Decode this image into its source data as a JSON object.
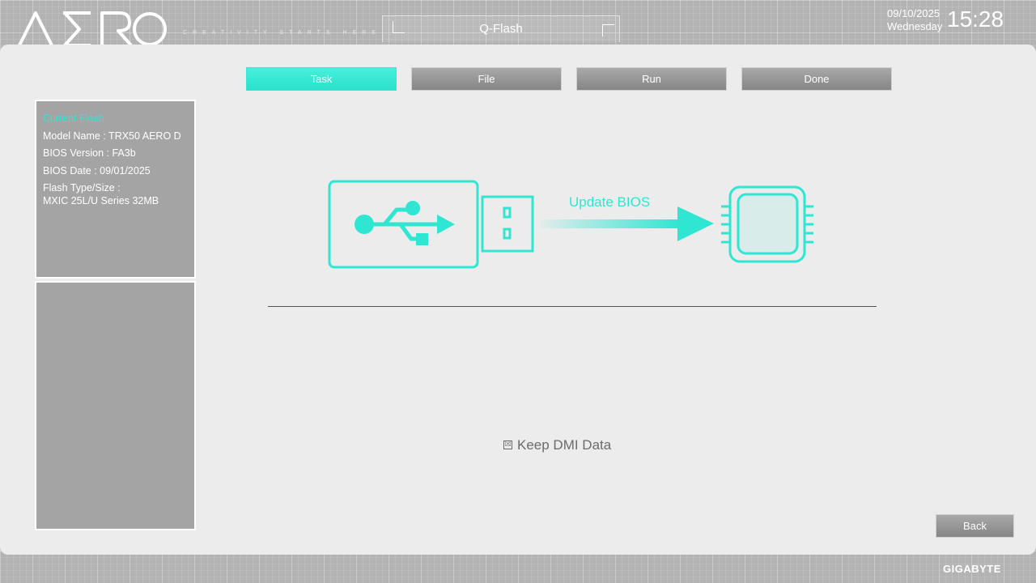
{
  "header": {
    "logo_text": "AERO",
    "tagline": "CREATIVITY STARTS HERE",
    "title": "Q-Flash",
    "date": "09/10/2025",
    "weekday": "Wednesday",
    "time": "15:28"
  },
  "tabs": [
    {
      "label": "Task",
      "active": true
    },
    {
      "label": "File",
      "active": false
    },
    {
      "label": "Run",
      "active": false
    },
    {
      "label": "Done",
      "active": false
    }
  ],
  "current_flash": {
    "heading": "Current Flash",
    "model": "Model Name : TRX50 AERO D",
    "bios_version": "BIOS Version : FA3b",
    "bios_date": "BIOS Date : 09/01/2025",
    "flash_type_label": "Flash Type/Size :",
    "flash_type_value": "MXIC 25L/U Series  32MB"
  },
  "illustration": {
    "label": "Update BIOS",
    "icons": [
      "usb-drive-icon",
      "arrow-right-icon",
      "chip-icon"
    ]
  },
  "options": {
    "keep_dmi_label": "Keep DMI Data",
    "keep_dmi_checked": true,
    "checkbox_glyph": "☒"
  },
  "footer": {
    "back_label": "Back",
    "brand": "GIGABYTE"
  },
  "colors": {
    "accent": "#2FE6D2",
    "panel": "#ECECEC",
    "button": "#959595"
  }
}
